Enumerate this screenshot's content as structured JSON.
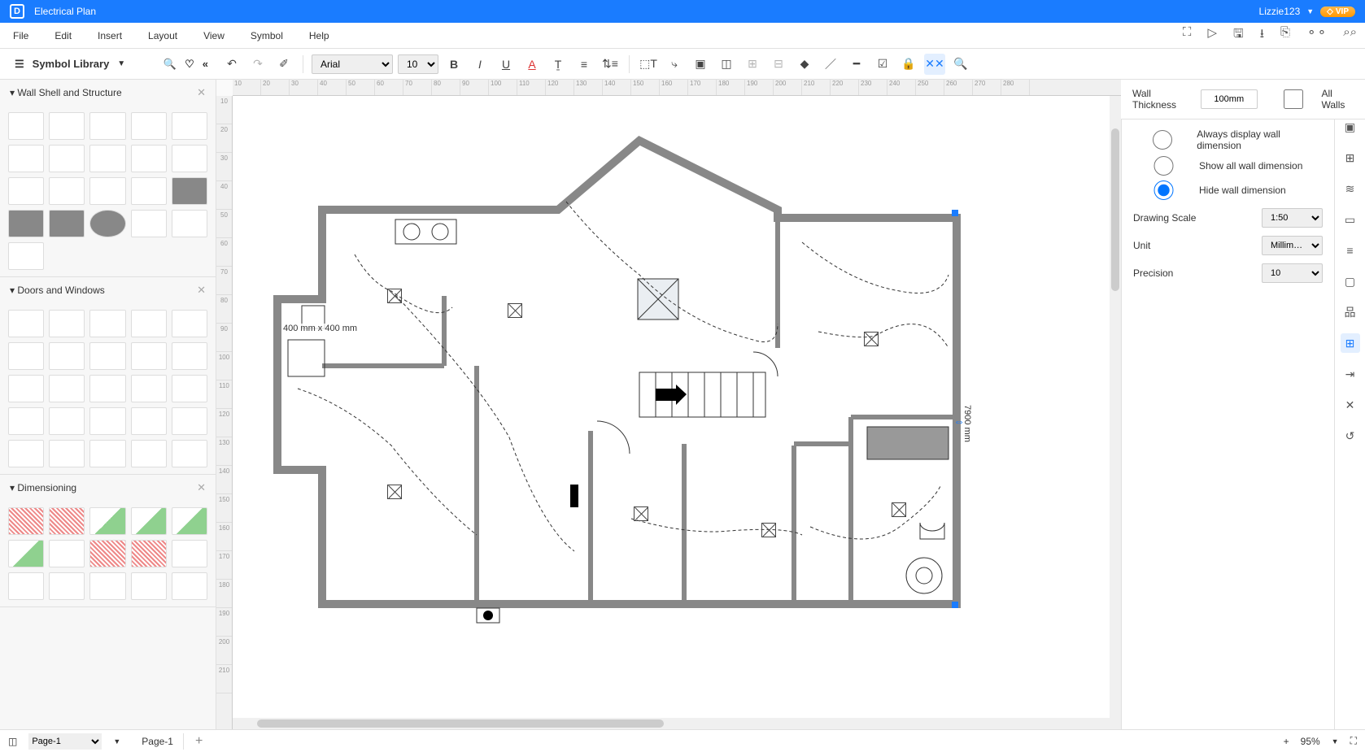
{
  "title": "Electrical Plan",
  "user": {
    "name": "Lizzie123",
    "badge": "VIP"
  },
  "menu": {
    "file": "File",
    "edit": "Edit",
    "insert": "Insert",
    "layout": "Layout",
    "view": "View",
    "symbol": "Symbol",
    "help": "Help"
  },
  "symbol_library": {
    "title": "Symbol Library"
  },
  "toolbar": {
    "font": "Arial",
    "font_size": "10"
  },
  "libs": {
    "wall": "Wall Shell and Structure",
    "doors": "Doors and Windows",
    "dim": "Dimensioning"
  },
  "wall_popup": {
    "label": "Wall Thickness",
    "value": "100mm",
    "all_walls": "All Walls"
  },
  "props": {
    "radio1": "Always display wall dimension",
    "radio2": "Show all wall dimension",
    "radio3": "Hide wall dimension",
    "scale_label": "Drawing Scale",
    "scale_value": "1:50",
    "unit_label": "Unit",
    "unit_value": "Millim…",
    "precision_label": "Precision",
    "precision_value": "10"
  },
  "canvas": {
    "shape_label": "400 mm x 400 mm",
    "dim_right": "7900 mm"
  },
  "ruler_h": [
    "10",
    "20",
    "30",
    "40",
    "50",
    "60",
    "70",
    "80",
    "90",
    "100",
    "110",
    "120",
    "130",
    "140",
    "150",
    "160",
    "170",
    "180",
    "190",
    "200",
    "210",
    "220",
    "230",
    "240",
    "250",
    "260",
    "270",
    "280"
  ],
  "ruler_v": [
    "10",
    "20",
    "30",
    "40",
    "50",
    "60",
    "70",
    "80",
    "90",
    "100",
    "110",
    "120",
    "130",
    "140",
    "150",
    "160",
    "170",
    "180",
    "190",
    "200",
    "210"
  ],
  "footer": {
    "page_select": "Page-1",
    "page_tab": "Page-1",
    "zoom": "95%"
  }
}
